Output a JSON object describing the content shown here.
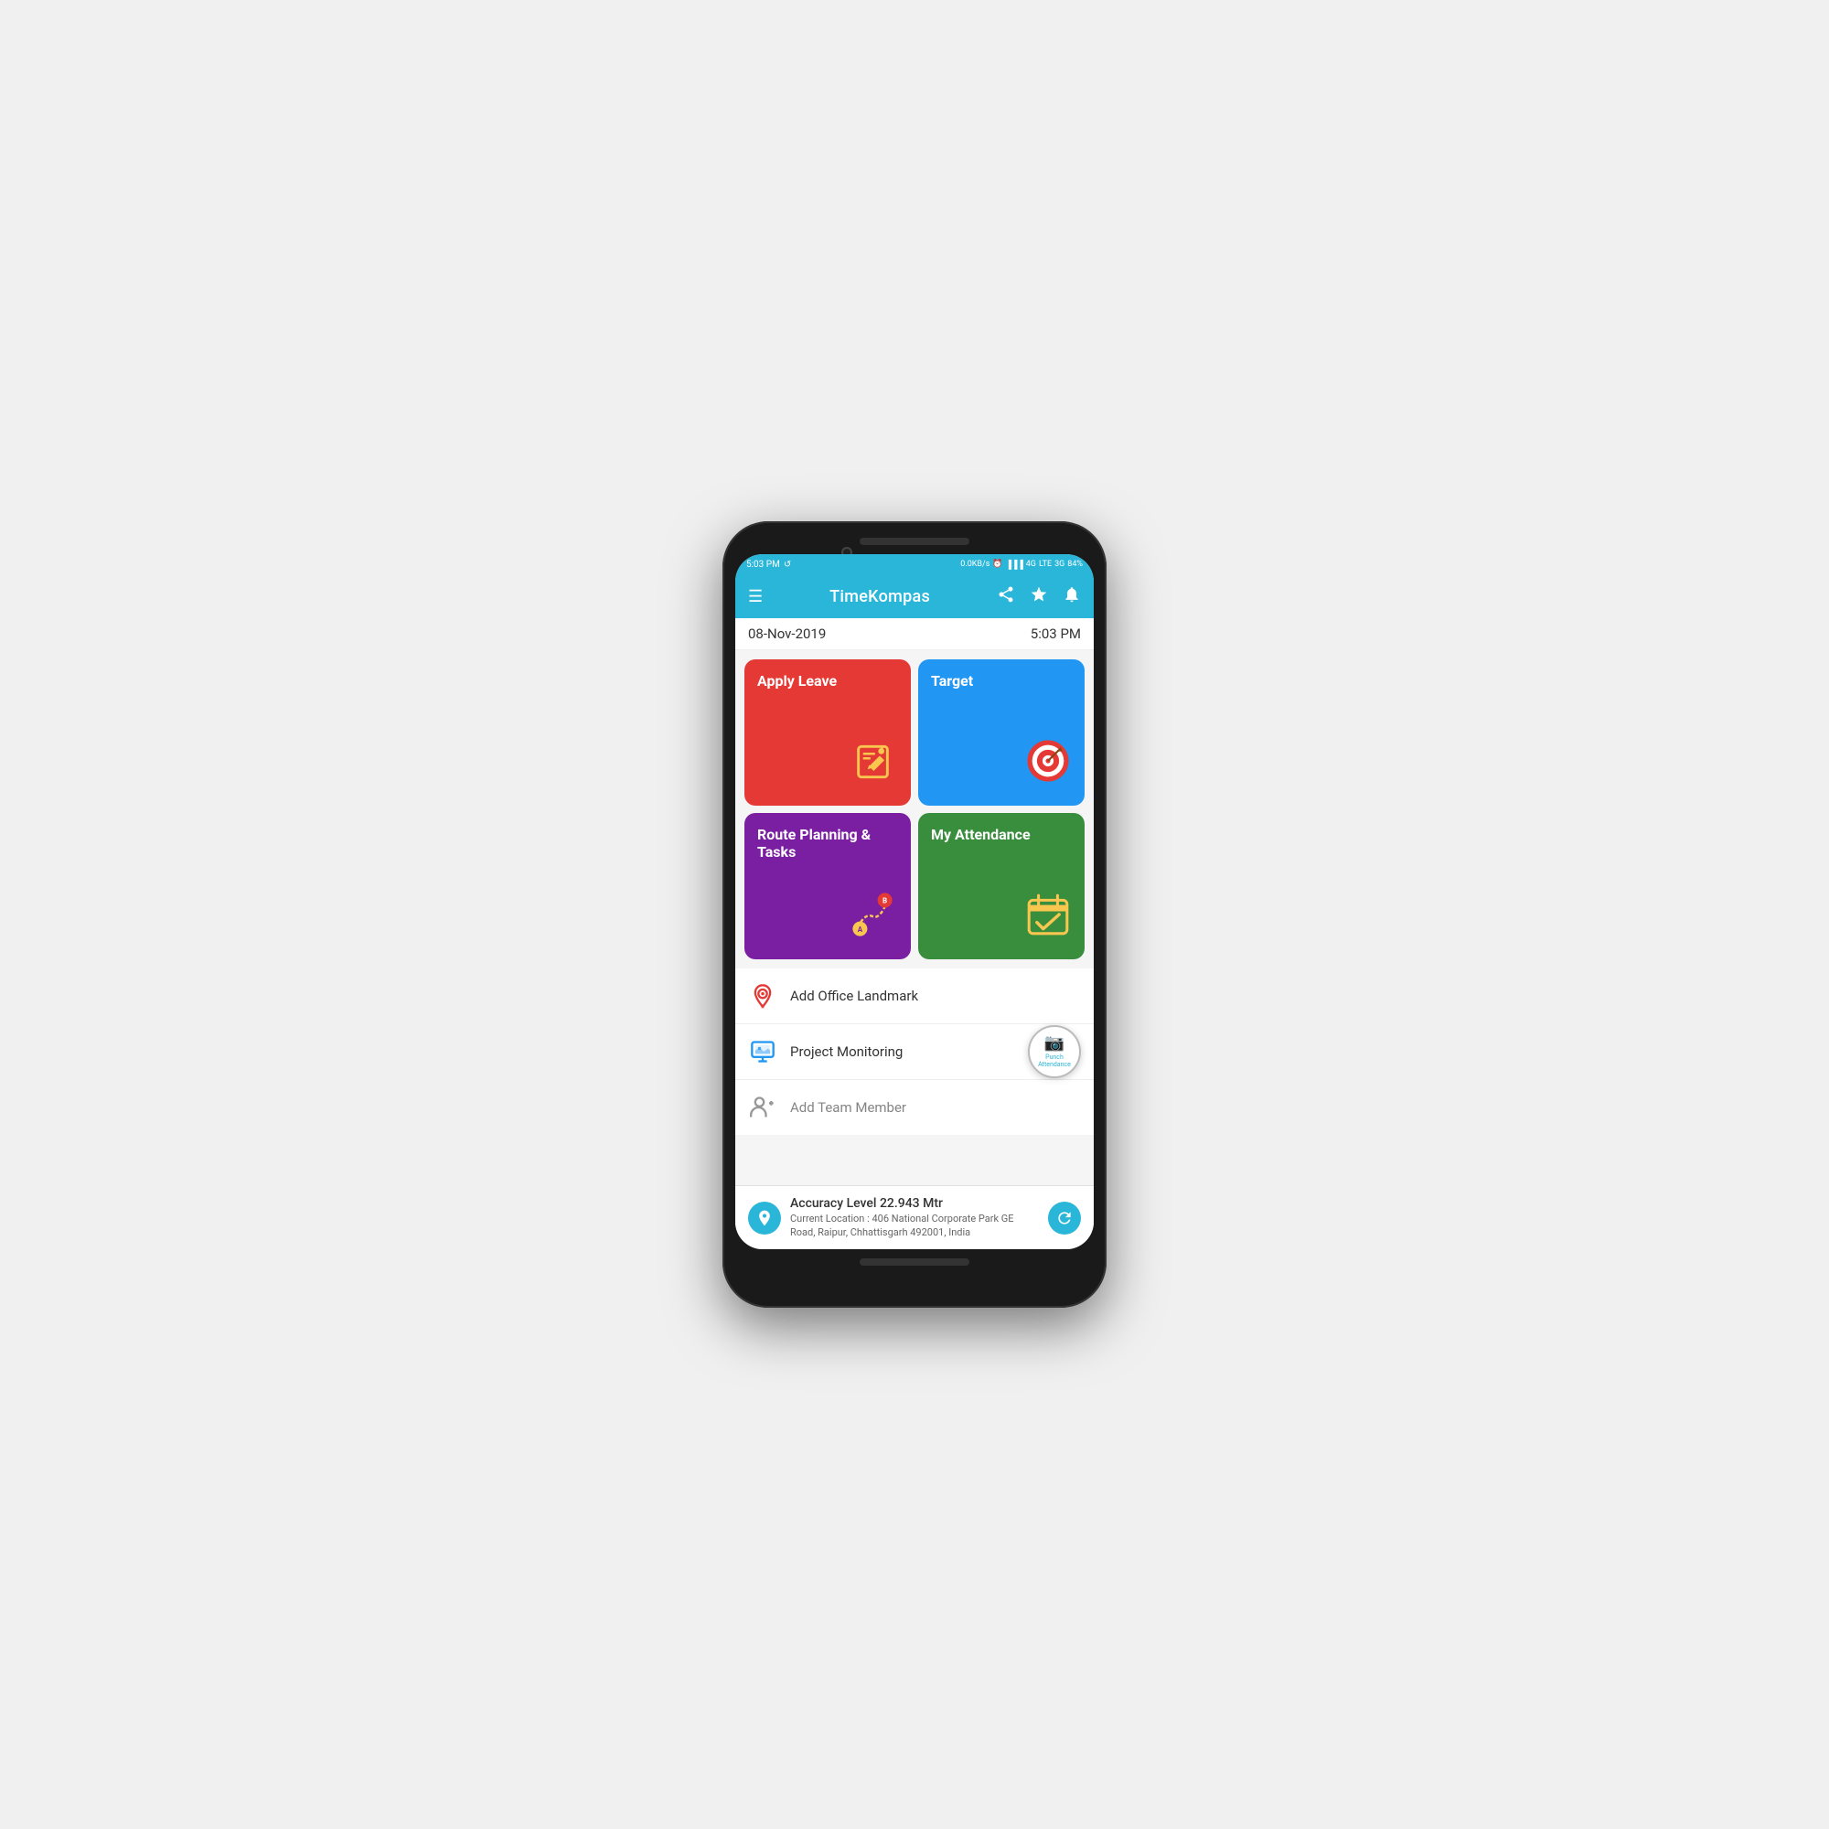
{
  "statusBar": {
    "time": "5:03 PM",
    "network": "0.0KB/s",
    "battery": "84",
    "signals": "4G · 3G"
  },
  "appBar": {
    "title": "TimeKompas",
    "menuIcon": "☰",
    "shareIcon": "⊲",
    "starIcon": "★",
    "bellIcon": "🔔"
  },
  "dateBar": {
    "date": "08-Nov-2019",
    "time": "5:03 PM"
  },
  "cards": [
    {
      "id": "apply-leave",
      "label": "Apply Leave",
      "color": "#e53935",
      "iconType": "edit"
    },
    {
      "id": "target",
      "label": "Target",
      "color": "#2196f3",
      "iconType": "target"
    },
    {
      "id": "route-planning",
      "label": "Route Planning & Tasks",
      "color": "#7b1fa2",
      "iconType": "route"
    },
    {
      "id": "my-attendance",
      "label": "My Attendance",
      "color": "#388e3c",
      "iconType": "calendar"
    }
  ],
  "listItems": [
    {
      "id": "add-office-landmark",
      "label": "Add Office Landmark",
      "iconColor": "#e53935",
      "iconType": "location-pin"
    },
    {
      "id": "project-monitoring",
      "label": "Project Monitoring",
      "iconColor": "#2196f3",
      "iconType": "monitor"
    },
    {
      "id": "add-team-member",
      "label": "Add Team Member",
      "iconColor": "#555",
      "iconType": "person"
    }
  ],
  "punchAttendance": {
    "label": "Punch Attendance",
    "iconType": "camera"
  },
  "bottomBar": {
    "accuracyLabel": "Accuracy Level 22.943 Mtr",
    "locationLabel": "Current Location : 406 National Corporate Park GE Road, Raipur, Chhattisgarh 492001, India"
  }
}
